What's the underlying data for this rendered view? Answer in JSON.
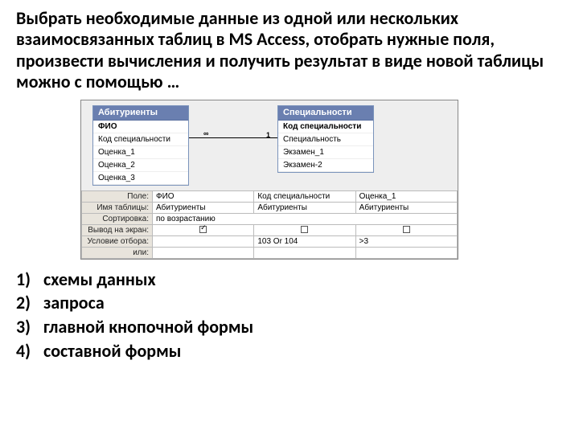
{
  "question": "Выбрать необходимые данные из одной или нескольких взаимосвязанных таблиц в MS Access, отобрать нужные поля, произвести вычисления и получить результат в виде новой таблицы можно с помощью …",
  "relation": {
    "left_symbol": "∞",
    "right_symbol": "1"
  },
  "table1": {
    "title": "Абитуриенты",
    "fields": [
      "ФИО",
      "Код специальности",
      "Оценка_1",
      "Оценка_2",
      "Оценка_3"
    ]
  },
  "table2": {
    "title": "Специальности",
    "fields": [
      "Код специальности",
      "Специальность",
      "Экзамен_1",
      "Экзамен-2"
    ]
  },
  "grid": {
    "row_labels": [
      "Поле:",
      "Имя таблицы:",
      "Сортировка:",
      "Вывод на экран:",
      "Условие отбора:",
      "или:"
    ],
    "cols": [
      {
        "field": "ФИО",
        "table": "Абитуриенты",
        "sort": "по возрастанию",
        "show": true,
        "criteria": ""
      },
      {
        "field": "Код специальности",
        "table": "Абитуриенты",
        "sort": "",
        "show": false,
        "criteria": "103 Or 104"
      },
      {
        "field": "Оценка_1",
        "table": "Абитуриенты",
        "sort": "",
        "show": false,
        "criteria": ">3"
      }
    ]
  },
  "answers": [
    {
      "num": "1)",
      "text": "схемы данных"
    },
    {
      "num": "2)",
      "text": "запроса"
    },
    {
      "num": "3)",
      "text": "главной кнопочной формы"
    },
    {
      "num": "4)",
      "text": "составной формы"
    }
  ]
}
